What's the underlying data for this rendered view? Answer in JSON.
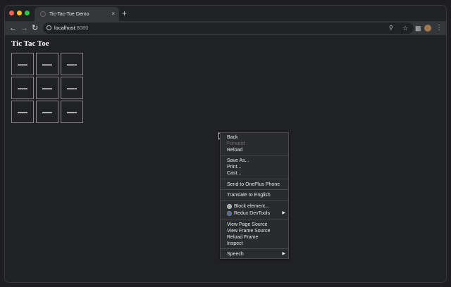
{
  "browser": {
    "tab_title": "Tic-Tac-Toe Demo",
    "tab_close": "×",
    "new_tab": "+",
    "url_host": "localhost",
    "url_port": ":8080"
  },
  "page": {
    "title": "Tic Tac Toe",
    "cells": [
      "—",
      "—",
      "—",
      "—",
      "—",
      "—",
      "—",
      "—",
      "—"
    ]
  },
  "context_menu": {
    "back": "Back",
    "forward": "Forward",
    "reload": "Reload",
    "save_as": "Save As...",
    "print": "Print...",
    "cast": "Cast...",
    "send_to_phone": "Send to OnePlus Phone",
    "translate": "Translate to English",
    "block_element": "Block element...",
    "redux_devtools": "Redux DevTools",
    "view_page_source": "View Page Source",
    "view_frame_source": "View Frame Source",
    "reload_frame": "Reload Frame",
    "inspect": "Inspect",
    "speech": "Speech",
    "submenu_arrow": "▶"
  }
}
